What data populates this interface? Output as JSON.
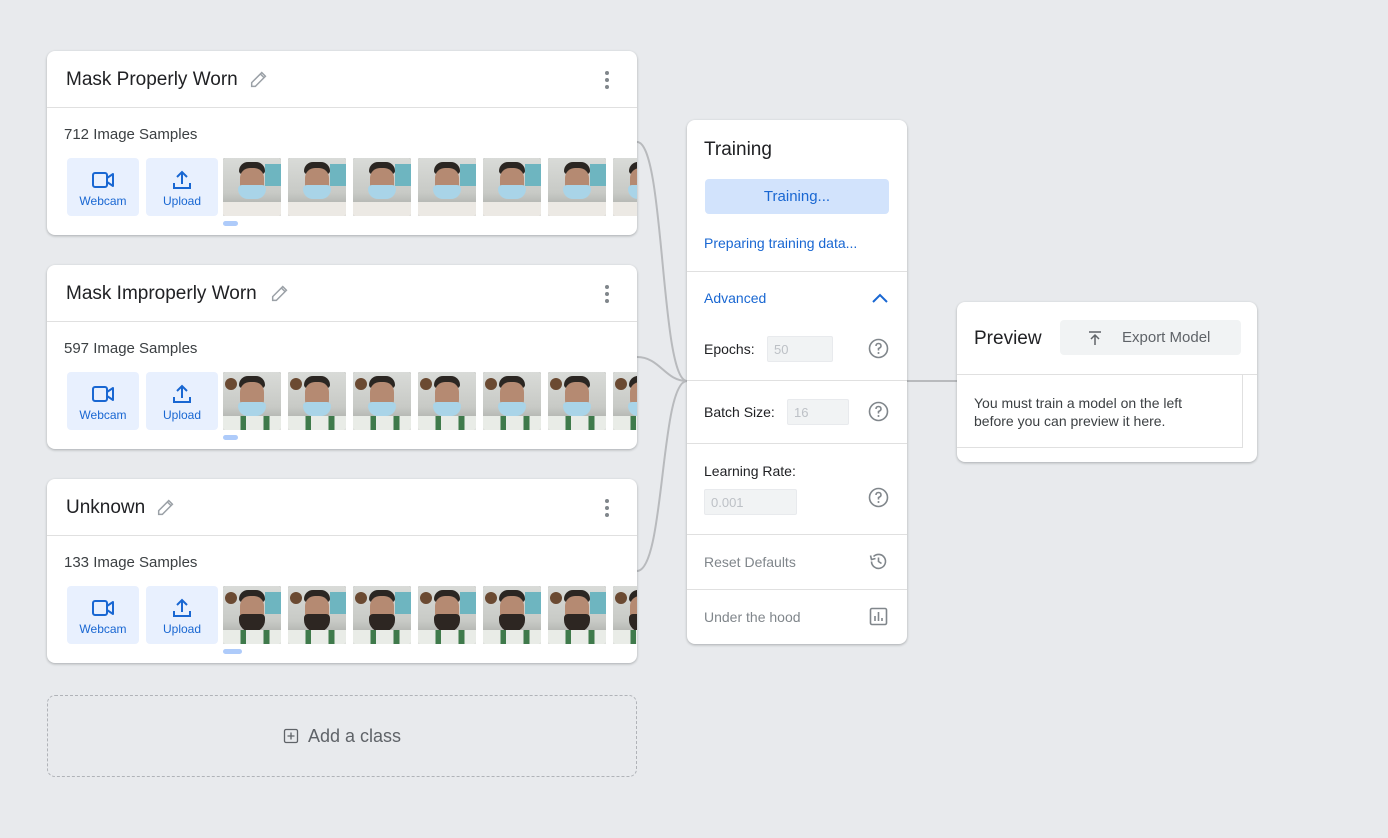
{
  "classes": [
    {
      "title": "Mask Properly Worn",
      "samples": "712 Image Samples",
      "variant": "mask"
    },
    {
      "title": "Mask Improperly Worn",
      "samples": "597 Image Samples",
      "variant": "mask"
    },
    {
      "title": "Unknown",
      "samples": "133 Image Samples",
      "variant": "beard"
    }
  ],
  "sample_buttons": {
    "webcam": "Webcam",
    "upload": "Upload"
  },
  "add_class": "Add a class",
  "training": {
    "title": "Training",
    "button": "Training...",
    "status": "Preparing training data...",
    "advanced": "Advanced",
    "epochs_label": "Epochs:",
    "epochs_value": "50",
    "batch_label": "Batch Size:",
    "batch_value": "16",
    "lr_label": "Learning Rate:",
    "lr_value": "0.001",
    "reset": "Reset Defaults",
    "under_hood": "Under the hood"
  },
  "preview": {
    "title": "Preview",
    "export": "Export Model",
    "message": "You must train a model on the left before you can preview it here."
  },
  "colors": {
    "accent": "#1967d2",
    "accent_light": "#e8f0fe",
    "background": "#e8eaed"
  }
}
